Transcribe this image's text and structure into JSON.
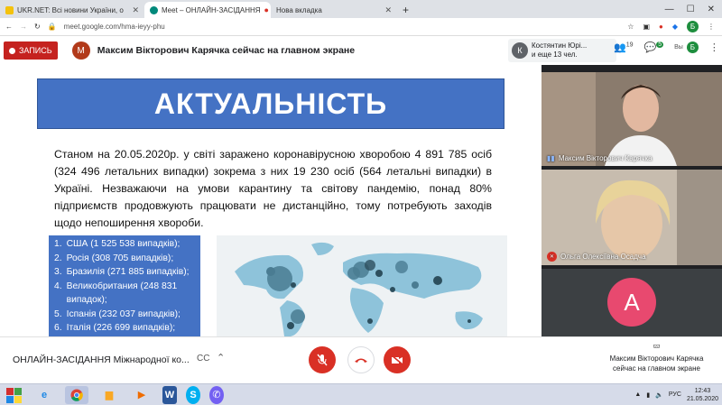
{
  "browser": {
    "tabs": [
      {
        "label": "UKR.NET: Всі новини України, о",
        "active": false
      },
      {
        "label": "Meet – ОНЛАЙН-ЗАСІДАННЯ",
        "active": true
      },
      {
        "label": "Нова вкладка",
        "active": false
      }
    ],
    "new_tab_label": "+",
    "url": "meet.google.com/hma-ieyy-phu",
    "profile_initial": "Б"
  },
  "meet": {
    "record_label": "ЗАПИСЬ",
    "presenter_initial": "М",
    "presenter_text": "Максим Вікторович Карячка сейчас на главном экране",
    "participant_initial": "К",
    "participant_name": "Костянтин Юрі...",
    "participant_more": "и еще 13 чел.",
    "people_count": "19",
    "chat_count": "5",
    "you_label": "Вы",
    "self_initial": "Б"
  },
  "slide": {
    "title": "АКТУАЛЬНІСТЬ",
    "paragraph": "Станом на 20.05.2020р. у світі заражено коронавірусною хворобою 4 891 785 осіб (324 496 летальних випадки)  зокрема з них 19 230 осіб (564 летальні випадки) в Україні. Незважаючи на  умови карантину та світову пандемію, понад 80% підприємств продовжують працювати не дистанційно, тому потребують заходів щодо непоширення хвороби.",
    "list": [
      {
        "num": "1.",
        "text": "США (1 525 538 випадків);"
      },
      {
        "num": "2.",
        "text": "Росія  (308 705 випадків);"
      },
      {
        "num": "3.",
        "text": "Бразилія (271 885 випадків);"
      },
      {
        "num": "4.",
        "text": "Великобритания (248 831 випадок);"
      },
      {
        "num": "5.",
        "text": "Іспанія (232 037 випадків);"
      },
      {
        "num": "6.",
        "text": "Італія (226 699 випадків);"
      }
    ]
  },
  "tiles": {
    "tile1_name": "Максим Вікторович Карячка",
    "tile2_name": "Ольга Олексіївна Осадча",
    "tile3_initial": "А"
  },
  "controls": {
    "meeting_title": "ОНЛАЙН-ЗАСІДАННЯ Міжнародної ко...",
    "cc_label": "CC",
    "present_line1": "Максим Вікторович Карячка",
    "present_line2": "сейчас на главном экране"
  },
  "taskbar": {
    "lang": "РУС",
    "time": "12:43",
    "date": "21.05.2020"
  },
  "colors": {
    "record": "#c5221f",
    "slide_blue": "#4472c4",
    "hangup": "#d93025",
    "avatar_pink": "#e8496f"
  }
}
